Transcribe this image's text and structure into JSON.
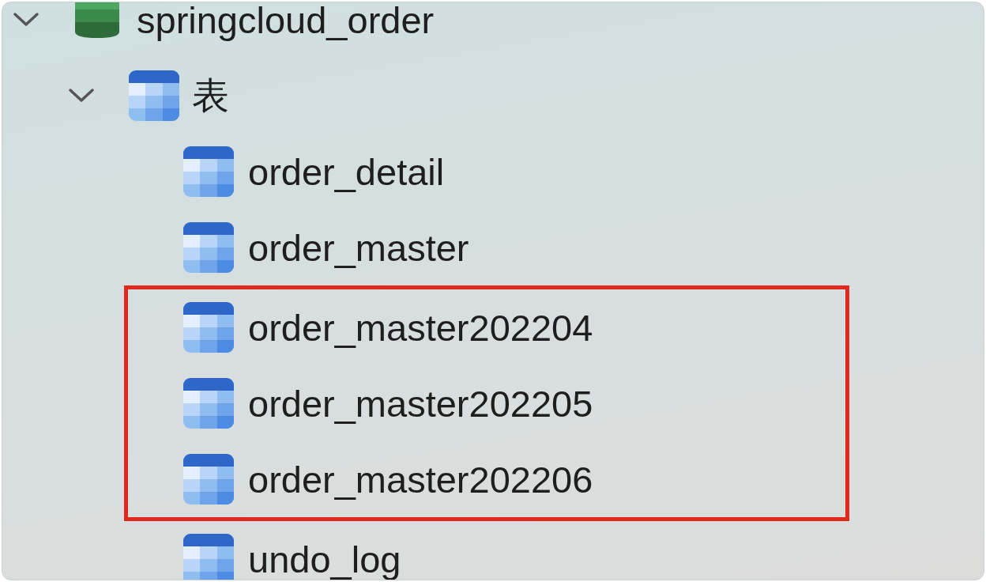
{
  "tree": {
    "label": "springcloud_order",
    "kind": "database",
    "expanded": true,
    "children": [
      {
        "label": "表",
        "kind": "folder",
        "expanded": true,
        "children": [
          {
            "label": "order_detail",
            "highlighted": false
          },
          {
            "label": "order_master",
            "highlighted": false
          },
          {
            "label": "order_master202204",
            "highlighted": true
          },
          {
            "label": "order_master202205",
            "highlighted": true
          },
          {
            "label": "order_master202206",
            "highlighted": true
          },
          {
            "label": "undo_log",
            "highlighted": false
          }
        ]
      }
    ]
  }
}
